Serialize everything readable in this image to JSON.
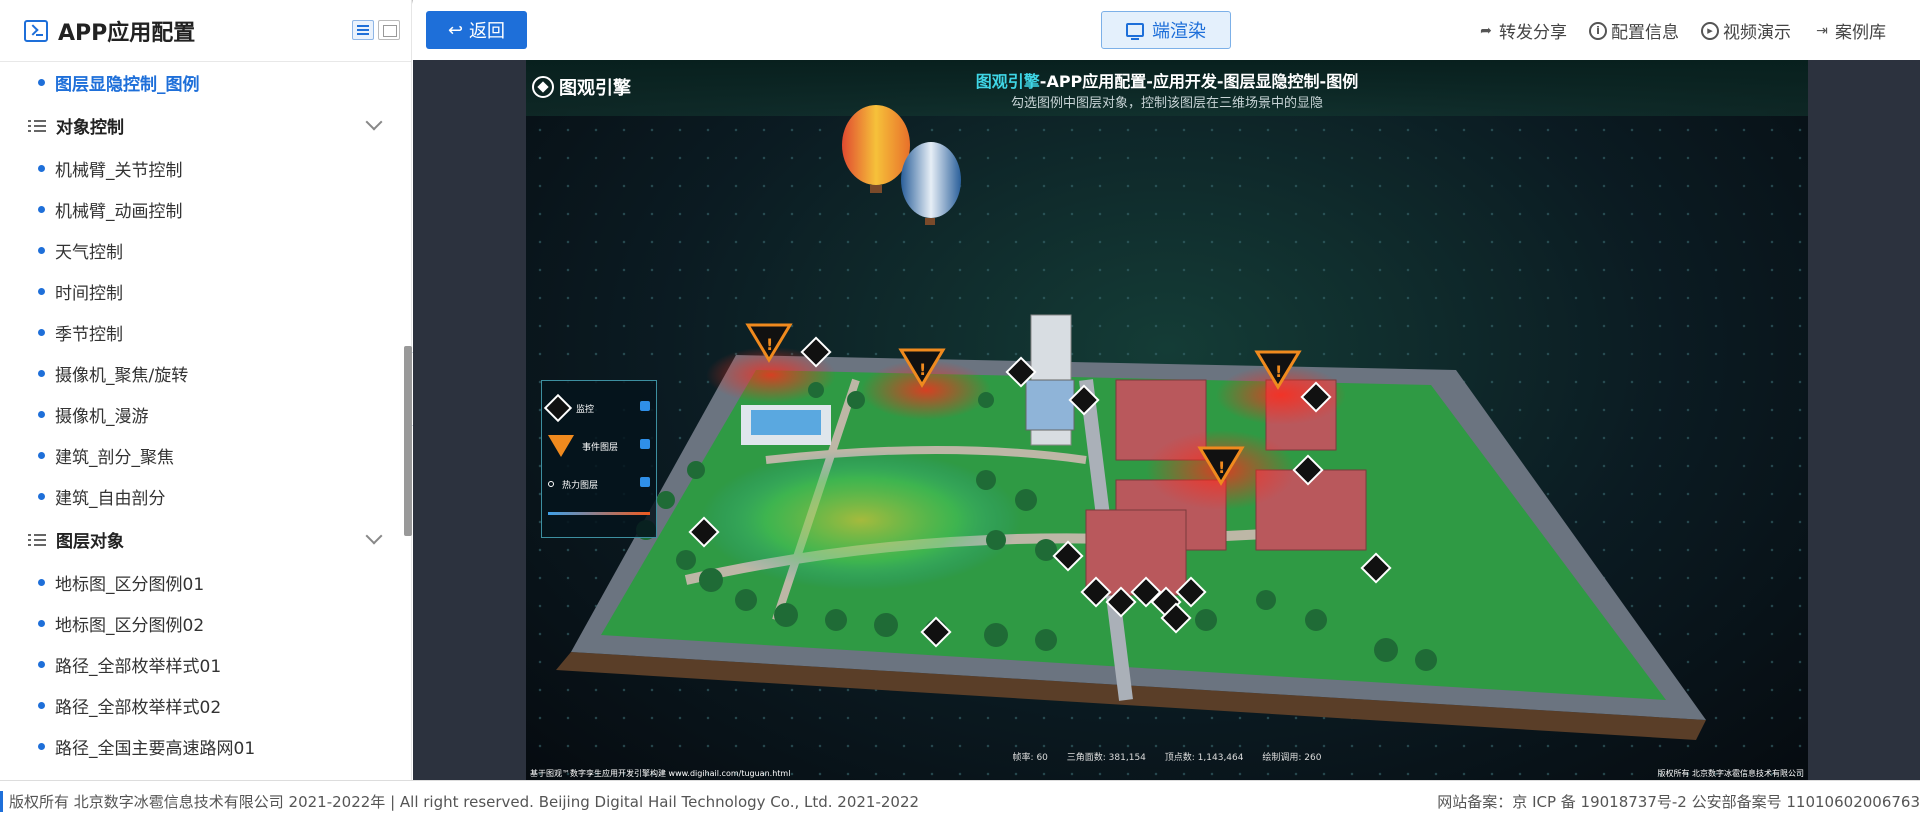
{
  "sidebar": {
    "title": "APP应用配置",
    "items_top": [
      {
        "label": "图层显隐控制_图例",
        "active": true
      }
    ],
    "groups": [
      {
        "label": "对象控制",
        "items": [
          "机械臂_关节控制",
          "机械臂_动画控制",
          "天气控制",
          "时间控制",
          "季节控制",
          "摄像机_聚焦/旋转",
          "摄像机_漫游",
          "建筑_剖分_聚焦",
          "建筑_自由剖分"
        ]
      },
      {
        "label": "图层对象",
        "items": [
          "地标图_区分图例01",
          "地标图_区分图例02",
          "路径_全部枚举样式01",
          "路径_全部枚举样式02",
          "路径_全国主要高速路网01"
        ]
      }
    ]
  },
  "toolbar": {
    "back_label": "返回",
    "render_label": "端渲染",
    "tools": [
      {
        "label": "转发分享",
        "icon": "share-icon"
      },
      {
        "label": "配置信息",
        "icon": "info-icon"
      },
      {
        "label": "视频演示",
        "icon": "play-icon"
      },
      {
        "label": "案例库",
        "icon": "export-icon"
      }
    ]
  },
  "scene": {
    "brand": "图观引擎",
    "title_highlight": "图观引擎",
    "title_rest": "-APP应用配置-应用开发-图层显隐控制-图例",
    "subtitle": "勾选图例中图层对象，控制该图层在三维场景中的显隐",
    "legend": [
      {
        "label": "监控",
        "icon": "camera-icon",
        "checked": true
      },
      {
        "label": "事件图层",
        "icon": "event-warning-icon",
        "checked": true
      },
      {
        "label": "热力图层",
        "icon": "heat-icon",
        "checked": true
      }
    ],
    "stats": [
      "帧率: 60",
      "三角面数: 381,154",
      "顶点数: 1,143,464",
      "绘制调用: 260"
    ],
    "footer_left": "基于图观™数字孪生应用开发引擎构建 www.digihail.com/tuguan.html",
    "footer_right": "版权所有 北京数字冰雹信息技术有限公司"
  },
  "footer": {
    "copyright": "版权所有 北京数字冰雹信息技术有限公司 2021-2022年 | All right reserved. Beijing Digital Hail Technology Co., Ltd. 2021-2022",
    "icp": "网站备案：京 ICP 备 19018737号-2 公安部备案号 11010602006763"
  },
  "colors": {
    "accent": "#1e6fd9",
    "scene_highlight": "#3fd6e6",
    "event": "#f08a1e"
  }
}
